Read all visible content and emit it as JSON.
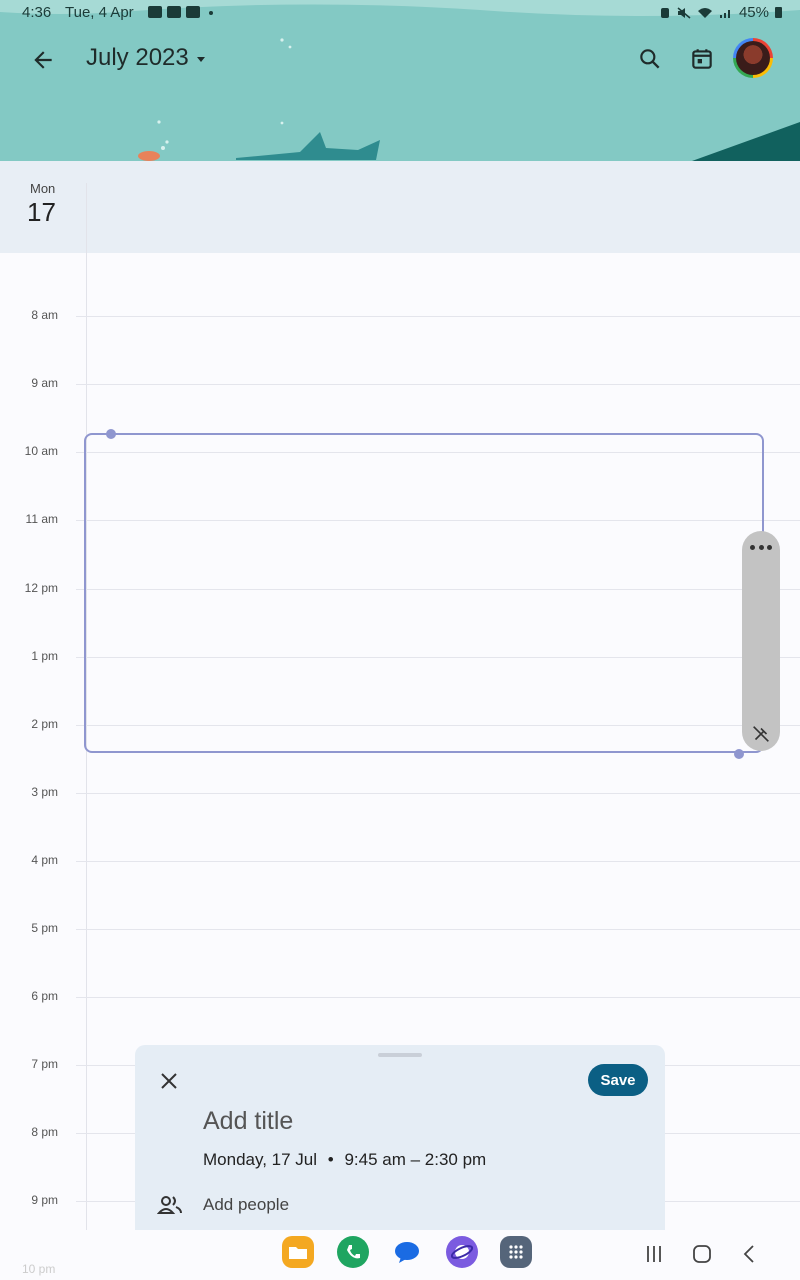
{
  "status_bar": {
    "time": "4:36",
    "date": "Tue, 4 Apr",
    "battery": "45%"
  },
  "header": {
    "month_title": "July 2023"
  },
  "day": {
    "weekday": "Mon",
    "number": "17"
  },
  "hours": [
    "8 am",
    "9 am",
    "10 am",
    "11 am",
    "12 pm",
    "1 pm",
    "2 pm",
    "3 pm",
    "4 pm",
    "5 pm",
    "6 pm",
    "7 pm",
    "8 pm",
    "9 pm",
    "10 pm"
  ],
  "sheet": {
    "save_label": "Save",
    "title_placeholder": "Add title",
    "date_text": "Monday, 17 Jul",
    "separator": "•",
    "time_range": "9:45 am – 2:30 pm",
    "add_people": "Add people"
  },
  "dock": [
    "my-files-icon",
    "phone-icon",
    "messages-icon",
    "internet-icon",
    "apps-icon"
  ],
  "colors": {
    "header_bg": "#83c9c4",
    "accent": "#0b5f84",
    "event_border": "#8f96cf"
  }
}
